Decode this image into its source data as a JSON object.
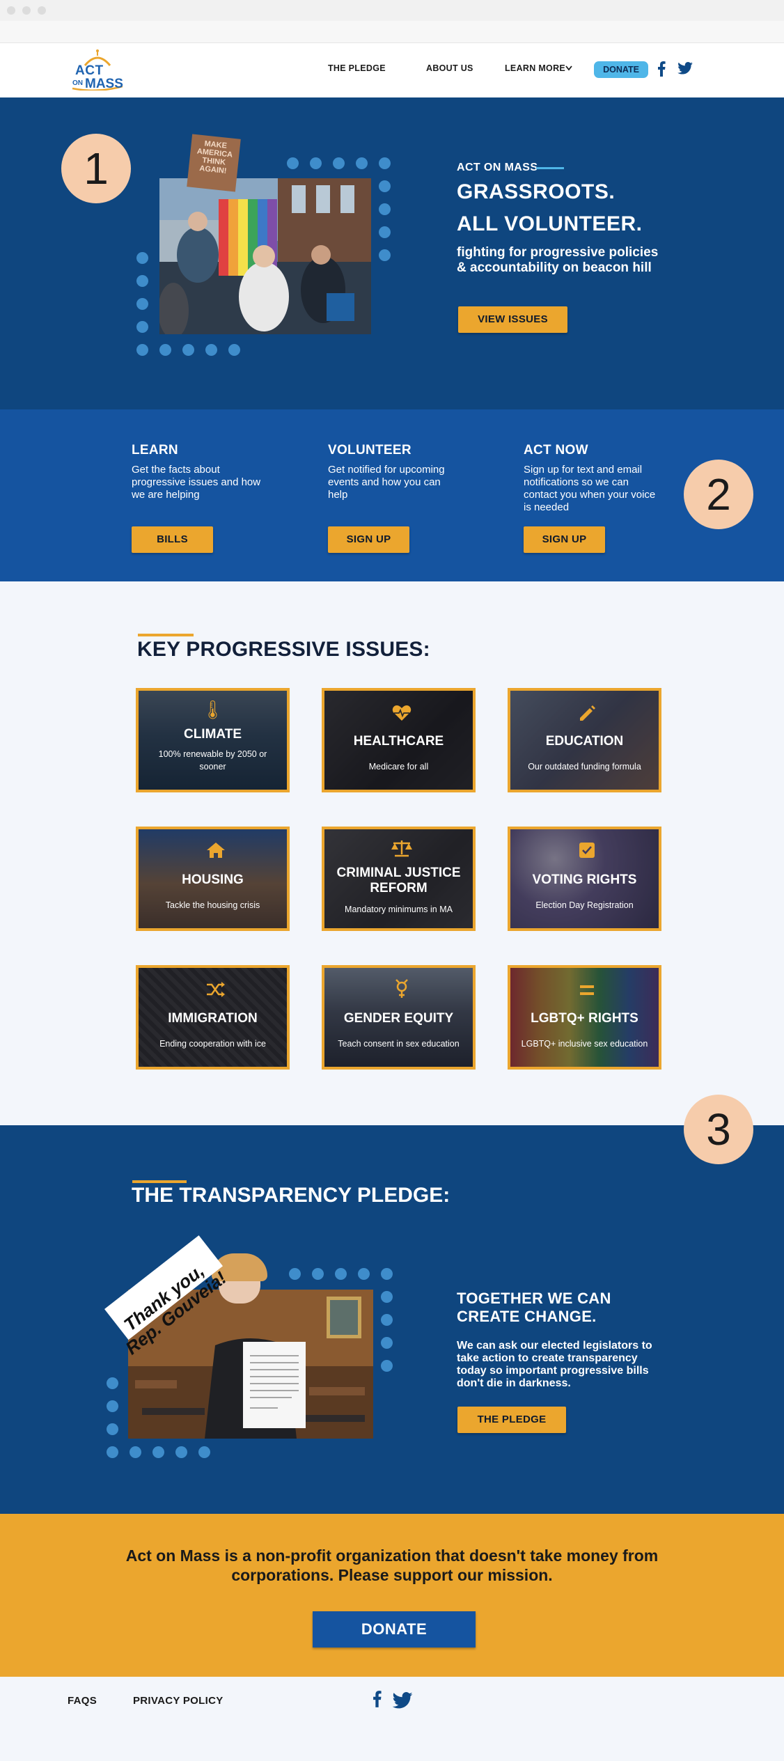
{
  "nav": {
    "logo_act": "ACT",
    "logo_on": "ON",
    "logo_mass": "MASS",
    "links": [
      "THE PLEDGE",
      "ABOUT US",
      "LEARN MORE"
    ],
    "donate": "DONATE",
    "social_icons": [
      "facebook-icon",
      "twitter-icon"
    ]
  },
  "hero": {
    "number": "1",
    "eyebrow": "ACT ON MASS",
    "headline_1": "GRASSROOTS.",
    "headline_2": "ALL VOLUNTEER.",
    "subtitle": "fighting for progressive policies & accountability on beacon hill",
    "button": "VIEW ISSUES",
    "sign_text": "MAKE AMERICA THINK AGAIN!"
  },
  "columns": [
    {
      "title": "LEARN",
      "text": "Get the facts about progressive issues and how we are helping",
      "button": "BILLS"
    },
    {
      "title": "VOLUNTEER",
      "text": "Get notified for upcoming events and how you can help",
      "button": "SIGN UP"
    },
    {
      "title": "ACT NOW",
      "text": "Sign up for text and email notifications so we can contact you when your voice is needed",
      "button": "SIGN UP"
    }
  ],
  "columns_number": "2",
  "issues": {
    "heading": "KEY PROGRESSIVE ISSUES:",
    "cards": [
      {
        "title": "CLIMATE",
        "sub": "100% renewable by 2050 or sooner",
        "icon": "thermometer-icon"
      },
      {
        "title": "HEALTHCARE",
        "sub": "Medicare for all",
        "icon": "heart-pulse-icon"
      },
      {
        "title": "EDUCATION",
        "sub": "Our outdated funding formula",
        "icon": "pencil-icon"
      },
      {
        "title": "HOUSING",
        "sub": "Tackle the housing crisis",
        "icon": "home-icon"
      },
      {
        "title": "CRIMINAL JUSTICE REFORM",
        "sub": "Mandatory minimums in MA",
        "icon": "scales-icon"
      },
      {
        "title": "VOTING RIGHTS",
        "sub": "Election Day Registration",
        "icon": "checkbox-icon"
      },
      {
        "title": "IMMIGRATION",
        "sub": "Ending cooperation with ice",
        "icon": "shuffle-icon"
      },
      {
        "title": "GENDER EQUITY",
        "sub": "Teach consent in sex education",
        "icon": "gender-icon"
      },
      {
        "title": "LGBTQ+ RIGHTS",
        "sub": "LGBTQ+ inclusive sex education",
        "icon": "equals-icon"
      }
    ]
  },
  "pledge": {
    "number": "3",
    "heading": "THE TRANSPARENCY PLEDGE:",
    "banner": "Thank you, Rep. Gouveia!",
    "title": "TOGETHER WE CAN CREATE CHANGE.",
    "text": "We can ask our elected legislators to take action to create transparency today so important progressive bills don't die in darkness.",
    "button": "THE PLEDGE"
  },
  "support": {
    "text": "Act on Mass is a non-profit organization that doesn't take money from corporations. Please support our mission.",
    "button": "DONATE"
  },
  "footer": {
    "links": [
      "FAQS",
      "PRIVACY POLICY"
    ],
    "social_icons": [
      "facebook-icon",
      "twitter-icon"
    ]
  },
  "colors": {
    "navy": "#0f467f",
    "blue": "#1554a0",
    "orange": "#eba62e",
    "light_blue": "#4fb6e8",
    "peach": "#f6ccab"
  }
}
